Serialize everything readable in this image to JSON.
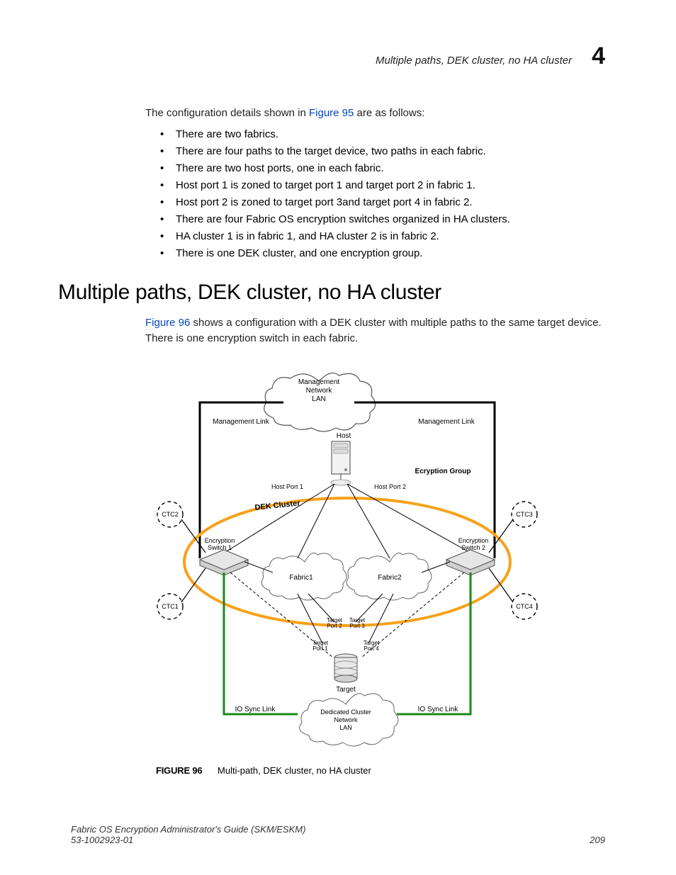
{
  "header": {
    "running_title": "Multiple paths, DEK cluster, no HA cluster",
    "chapter_number": "4"
  },
  "intro": {
    "prefix": "The configuration details shown in ",
    "ref": "Figure 95",
    "suffix": " are as follows:"
  },
  "bullets": [
    "There are two fabrics.",
    "There are four paths to the target device, two paths in each fabric.",
    "There are two host ports, one in each fabric.",
    "Host port 1 is zoned to target port 1 and target port 2 in fabric 1.",
    "Host port 2 is zoned to target port 3and target port 4 in fabric 2.",
    "There are four Fabric OS encryption switches organized in HA clusters.",
    "HA cluster 1 is in fabric 1, and HA cluster 2 is in fabric 2.",
    "There is one DEK cluster, and one encryption group."
  ],
  "section": {
    "title": "Multiple paths, DEK cluster, no HA cluster",
    "para_prefix": "",
    "ref": "Figure 96",
    "para_suffix": " shows a configuration with a DEK cluster with multiple paths to the same target device. There is one encryption switch in each fabric."
  },
  "figure": {
    "label": "FIGURE 96",
    "caption": "Multi-path, DEK cluster, no HA cluster",
    "labels": {
      "mgmt_lan_l1": "Management",
      "mgmt_lan_l2": "Network",
      "mgmt_lan_l3": "LAN",
      "mgmt_link_l": "Management Link",
      "mgmt_link_r": "Management Link",
      "host": "Host",
      "host_port1": "Host Port 1",
      "host_port2": "Host Port 2",
      "enc_group": "Ecryption Group",
      "dek_cluster": "DEK Cluster",
      "ctc1": "CTC1",
      "ctc2": "CTC2",
      "ctc3": "CTC3",
      "ctc4": "CTC4",
      "enc_sw1_l1": "Encryption",
      "enc_sw1_l2": "Switch 1",
      "enc_sw2_l1": "Encryption",
      "enc_sw2_l2": "Switch 2",
      "fabric1": "Fabric1",
      "fabric2": "Fabric2",
      "tp1_l1": "Target",
      "tp1_l2": "Port 1",
      "tp2_l1": "Target",
      "tp2_l2": "Port 2",
      "tp3_l1": "Target",
      "tp3_l2": "Port 3",
      "tp4_l1": "Target",
      "tp4_l2": "Port 4",
      "target": "Target",
      "io_sync_l": "IO Sync Link",
      "io_sync_r": "IO Sync Link",
      "cluster_lan_l1": "Dedicated Cluster",
      "cluster_lan_l2": "Network",
      "cluster_lan_l3": "LAN"
    }
  },
  "footer": {
    "left_l1": "Fabric OS Encryption Administrator's Guide (SKM/ESKM)",
    "left_l2": "53-1002923-01",
    "page": "209"
  }
}
